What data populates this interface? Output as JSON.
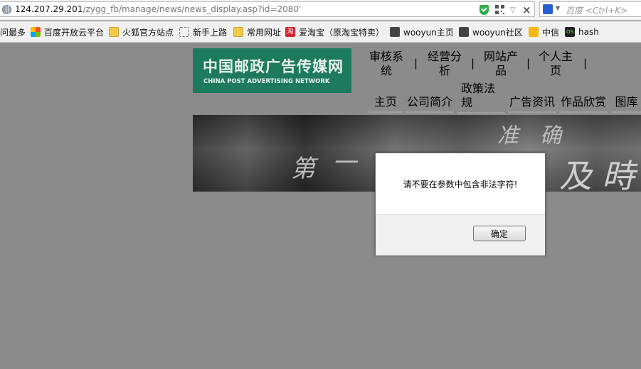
{
  "address_bar": {
    "url_host": "124.207.29.201",
    "url_path": "/zygg_fb/manage/news/news_display.asp?id=2080'",
    "search_placeholder": "百度 <Ctrl+K>",
    "search_engine_glyph": "🐾"
  },
  "bookmarks": [
    {
      "label": "问最多",
      "icon": "none"
    },
    {
      "label": "百度开放云平台",
      "icon": "windows-icon"
    },
    {
      "label": "火狐官方站点",
      "icon": "folder-icon"
    },
    {
      "label": "新手上路",
      "icon": "dashed-page-icon"
    },
    {
      "label": "常用网址",
      "icon": "folder-icon"
    },
    {
      "label": "爱淘宝（原淘宝特卖）",
      "icon": "taobao-icon",
      "glyph": "淘"
    },
    {
      "label": "wooyun主页",
      "icon": "wooyun-icon"
    },
    {
      "label": "wooyun社区",
      "icon": "wooyun-icon"
    },
    {
      "label": "中信",
      "icon": "citic-icon"
    },
    {
      "label": "hash",
      "icon": "hash-icon",
      "glyph": "OS"
    }
  ],
  "site": {
    "logo_cn": "中国邮政广告传媒网",
    "logo_en": "CHINA POST ADVERTISING NETWORK",
    "top_nav": [
      "审核系统",
      "经营分析",
      "网站产品",
      "个人主页"
    ],
    "top_nav_sep": "|",
    "main_nav": [
      "主页",
      "公司简介",
      "政策法规",
      "广告资讯",
      "作品欣赏",
      "图库"
    ],
    "banner_chars": [
      "第",
      "一",
      "准",
      "确",
      "及",
      "時"
    ]
  },
  "dialog": {
    "message": "请不要在参数中包含非法字符!",
    "ok_label": "确定"
  }
}
